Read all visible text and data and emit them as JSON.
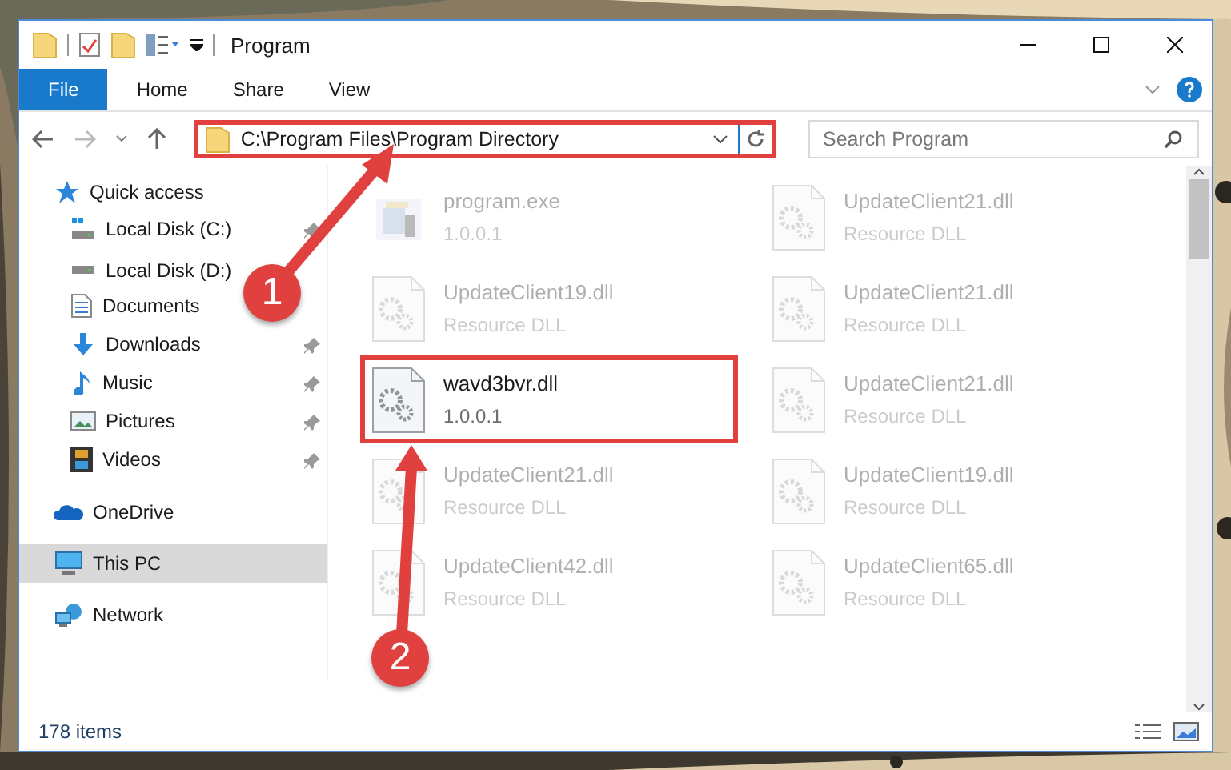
{
  "window": {
    "title": "Program"
  },
  "ribbon": {
    "tabs": [
      {
        "label": "File",
        "kind": "app"
      },
      {
        "label": "Home",
        "kind": "tab"
      },
      {
        "label": "Share",
        "kind": "tab"
      },
      {
        "label": "View",
        "kind": "tab"
      }
    ]
  },
  "address": {
    "path": "C:\\Program Files\\Program Directory",
    "annotated": true
  },
  "search": {
    "placeholder": "Search Program"
  },
  "sidebar": {
    "items": [
      {
        "label": "Quick access",
        "selected": false,
        "children": [
          {
            "label": "Local Disk (C:)",
            "pinned": true
          },
          {
            "label": "Local Disk (D:)",
            "pinned": false
          },
          {
            "label": "Documents",
            "pinned": false
          },
          {
            "label": "Downloads",
            "pinned": true
          },
          {
            "label": "Music",
            "pinned": true
          },
          {
            "label": "Pictures",
            "pinned": true
          },
          {
            "label": "Videos",
            "pinned": true
          }
        ]
      },
      {
        "label": "OneDrive",
        "selected": false
      },
      {
        "label": "This PC",
        "selected": true
      },
      {
        "label": "Network",
        "selected": false
      }
    ]
  },
  "files": [
    {
      "name": "program.exe",
      "detail": "1.0.0.1",
      "kind": "exe",
      "faded": true,
      "annotated": false
    },
    {
      "name": "UpdateClient21.dll",
      "detail": "Resource DLL",
      "kind": "dll",
      "faded": true,
      "annotated": false
    },
    {
      "name": "UpdateClient19.dll",
      "detail": "Resource DLL",
      "kind": "dll",
      "faded": true,
      "annotated": false
    },
    {
      "name": "UpdateClient21.dll",
      "detail": "Resource DLL",
      "kind": "dll",
      "faded": true,
      "annotated": false
    },
    {
      "name": "wavd3bvr.dll",
      "detail": "1.0.0.1",
      "kind": "dll",
      "faded": false,
      "annotated": true
    },
    {
      "name": "UpdateClient21.dll",
      "detail": "Resource DLL",
      "kind": "dll",
      "faded": true,
      "annotated": false
    },
    {
      "name": "UpdateClient21.dll",
      "detail": "Resource DLL",
      "kind": "dll",
      "faded": true,
      "annotated": false
    },
    {
      "name": "UpdateClient19.dll",
      "detail": "Resource DLL",
      "kind": "dll",
      "faded": true,
      "annotated": false
    },
    {
      "name": "UpdateClient42.dll",
      "detail": "Resource DLL",
      "kind": "dll",
      "faded": true,
      "annotated": false
    },
    {
      "name": "UpdateClient65.dll",
      "detail": "Resource DLL",
      "kind": "dll",
      "faded": true,
      "annotated": false
    }
  ],
  "status_bar": {
    "count": "178 items"
  },
  "annotations": [
    {
      "label": "1"
    },
    {
      "label": "2"
    }
  ]
}
